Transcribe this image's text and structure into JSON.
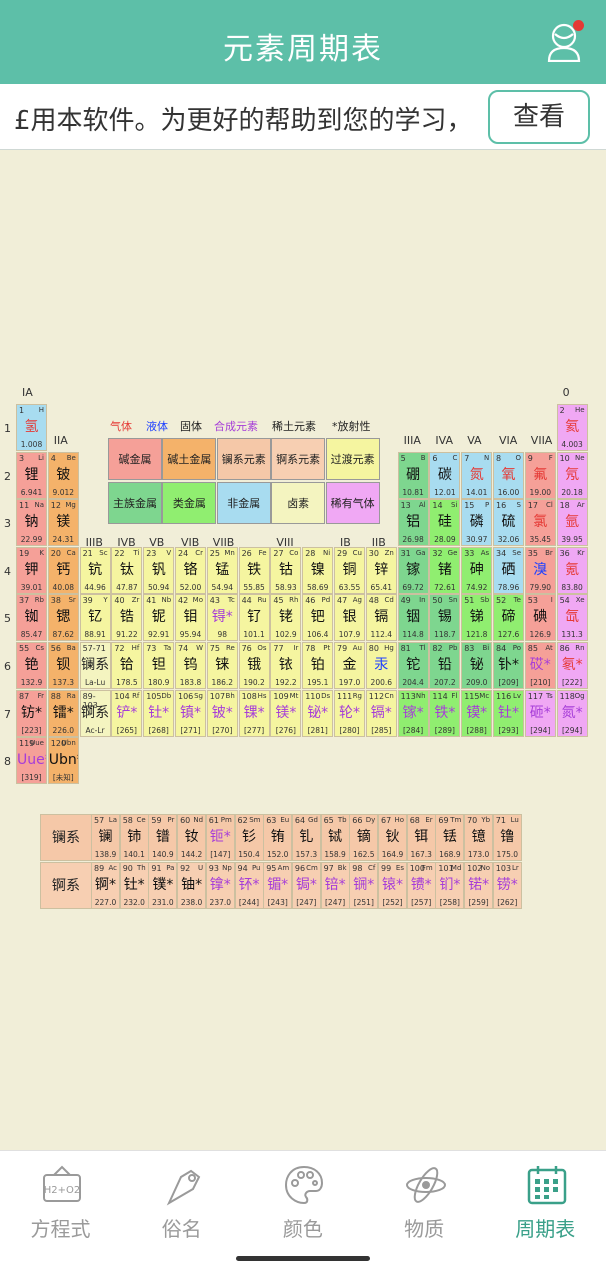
{
  "header": {
    "title": "元素周期表"
  },
  "banner": {
    "text": "£用本软件。为更好的帮助到您的学习，",
    "button": "查看"
  },
  "legend": {
    "gas": "气体",
    "liquid": "液体",
    "solid": "固体",
    "synthetic": "合成元素",
    "rare_earth": "稀土元素",
    "radioactive": "*放射性",
    "boxes": [
      "碱金属",
      "碱土金属",
      "镧系元素",
      "锕系元素",
      "过渡元素",
      "主族金属",
      "类金属",
      "非金属",
      "卤素",
      "稀有气体"
    ]
  },
  "groups": [
    "IA",
    "IIA",
    "IIIB",
    "IVB",
    "VB",
    "VIB",
    "VIIB",
    "VIII",
    "IB",
    "IIB",
    "IIIA",
    "IVA",
    "VA",
    "VIA",
    "VIIA",
    "0"
  ],
  "periods": [
    "1",
    "2",
    "3",
    "4",
    "5",
    "6",
    "7",
    "8"
  ],
  "placeholders": {
    "la": {
      "z": "57-71",
      "n": "镧系",
      "m": "La-Lu"
    },
    "ac": {
      "z": "89-103",
      "n": "锕系",
      "m": "Ac-Lr"
    }
  },
  "series_labels": {
    "lanthanides": "镧系",
    "actinides": "锕系"
  },
  "elements": [
    [
      "1",
      "H",
      "氢",
      "1.008",
      "hyd",
      "ng",
      0,
      0
    ],
    [
      "2",
      "He",
      "氦",
      "4.003",
      "nob",
      "ng",
      17,
      0
    ],
    [
      "3",
      "Li",
      "锂",
      "6.941",
      "alk",
      "",
      0,
      1
    ],
    [
      "4",
      "Be",
      "铍",
      "9.012",
      "ae",
      "",
      1,
      1
    ],
    [
      "5",
      "B",
      "硼",
      "10.81",
      "pm",
      "",
      12,
      1
    ],
    [
      "6",
      "C",
      "碳",
      "12.01",
      "hal",
      "",
      13,
      1
    ],
    [
      "7",
      "N",
      "氮",
      "14.01",
      "hal",
      "ng",
      14,
      1
    ],
    [
      "8",
      "O",
      "氧",
      "16.00",
      "hal",
      "ng",
      15,
      1
    ],
    [
      "9",
      "F",
      "氟",
      "19.00",
      "alk",
      "ng",
      16,
      1
    ],
    [
      "10",
      "Ne",
      "氖",
      "20.18",
      "nob",
      "ng",
      17,
      1
    ],
    [
      "11",
      "Na",
      "钠",
      "22.99",
      "alk",
      "",
      0,
      2
    ],
    [
      "12",
      "Mg",
      "镁",
      "24.31",
      "ae",
      "",
      1,
      2
    ],
    [
      "13",
      "Al",
      "铝",
      "26.98",
      "pm",
      "",
      12,
      2
    ],
    [
      "14",
      "Si",
      "硅",
      "28.09",
      "met",
      "",
      13,
      2
    ],
    [
      "15",
      "P",
      "磷",
      "30.97",
      "hal",
      "",
      14,
      2
    ],
    [
      "16",
      "S",
      "硫",
      "32.06",
      "hal",
      "",
      15,
      2
    ],
    [
      "17",
      "Cl",
      "氯",
      "35.45",
      "alk",
      "ng",
      16,
      2
    ],
    [
      "18",
      "Ar",
      "氩",
      "39.95",
      "nob",
      "ng",
      17,
      2
    ],
    [
      "19",
      "K",
      "钾",
      "39.01",
      "alk",
      "",
      0,
      3
    ],
    [
      "20",
      "Ca",
      "钙",
      "40.08",
      "ae",
      "",
      1,
      3
    ],
    [
      "21",
      "Sc",
      "钪",
      "44.96",
      "tm",
      "",
      2,
      3
    ],
    [
      "22",
      "Ti",
      "钛",
      "47.87",
      "tm",
      "",
      3,
      3
    ],
    [
      "23",
      "V",
      "钒",
      "50.94",
      "tm",
      "",
      4,
      3
    ],
    [
      "24",
      "Cr",
      "铬",
      "52.00",
      "tm",
      "",
      5,
      3
    ],
    [
      "25",
      "Mn",
      "锰",
      "54.94",
      "tm",
      "",
      6,
      3
    ],
    [
      "26",
      "Fe",
      "铁",
      "55.85",
      "tm",
      "",
      7,
      3
    ],
    [
      "27",
      "Co",
      "钴",
      "58.93",
      "tm",
      "",
      8,
      3
    ],
    [
      "28",
      "Ni",
      "镍",
      "58.69",
      "tm",
      "",
      9,
      3
    ],
    [
      "29",
      "Cu",
      "铜",
      "63.55",
      "tm",
      "",
      10,
      3
    ],
    [
      "30",
      "Zn",
      "锌",
      "65.41",
      "tm",
      "",
      11,
      3
    ],
    [
      "31",
      "Ga",
      "镓",
      "69.72",
      "pm",
      "",
      12,
      3
    ],
    [
      "32",
      "Ge",
      "锗",
      "72.61",
      "met",
      "",
      13,
      3
    ],
    [
      "33",
      "As",
      "砷",
      "74.92",
      "met",
      "",
      14,
      3
    ],
    [
      "34",
      "Se",
      "硒",
      "78.96",
      "hal",
      "",
      15,
      3
    ],
    [
      "35",
      "Br",
      "溴",
      "79.90",
      "alk",
      "lq",
      16,
      3
    ],
    [
      "36",
      "Kr",
      "氪",
      "83.80",
      "nob",
      "ng",
      17,
      3
    ],
    [
      "37",
      "Rb",
      "铷",
      "85.47",
      "alk",
      "",
      0,
      4
    ],
    [
      "38",
      "Sr",
      "锶",
      "87.62",
      "ae",
      "",
      1,
      4
    ],
    [
      "39",
      "Y",
      "钇",
      "88.91",
      "tm",
      "",
      2,
      4
    ],
    [
      "40",
      "Zr",
      "锆",
      "91.22",
      "tm",
      "",
      3,
      4
    ],
    [
      "41",
      "Nb",
      "铌",
      "92.91",
      "tm",
      "",
      4,
      4
    ],
    [
      "42",
      "Mo",
      "钼",
      "95.94",
      "tm",
      "",
      5,
      4
    ],
    [
      "43",
      "Tc",
      "锝*",
      "98",
      "tm",
      "sy",
      6,
      4
    ],
    [
      "44",
      "Ru",
      "钌",
      "101.1",
      "tm",
      "",
      7,
      4
    ],
    [
      "45",
      "Rh",
      "铑",
      "102.9",
      "tm",
      "",
      8,
      4
    ],
    [
      "46",
      "Pd",
      "钯",
      "106.4",
      "tm",
      "",
      9,
      4
    ],
    [
      "47",
      "Ag",
      "银",
      "107.9",
      "tm",
      "",
      10,
      4
    ],
    [
      "48",
      "Cd",
      "镉",
      "112.4",
      "tm",
      "",
      11,
      4
    ],
    [
      "49",
      "In",
      "铟",
      "114.8",
      "pm",
      "",
      12,
      4
    ],
    [
      "50",
      "Sn",
      "锡",
      "118.7",
      "pm",
      "",
      13,
      4
    ],
    [
      "51",
      "Sb",
      "锑",
      "121.8",
      "met",
      "",
      14,
      4
    ],
    [
      "52",
      "Te",
      "碲",
      "127.6",
      "met",
      "",
      15,
      4
    ],
    [
      "53",
      "I",
      "碘",
      "126.9",
      "alk",
      "",
      16,
      4
    ],
    [
      "54",
      "Xe",
      "氙",
      "131.3",
      "nob",
      "ng",
      17,
      4
    ],
    [
      "55",
      "Cs",
      "铯",
      "132.9",
      "alk",
      "",
      0,
      5
    ],
    [
      "56",
      "Ba",
      "钡",
      "137.3",
      "ae",
      "",
      1,
      5
    ],
    [
      "72",
      "Hf",
      "铪",
      "178.5",
      "tm",
      "",
      3,
      5
    ],
    [
      "73",
      "Ta",
      "钽",
      "180.9",
      "tm",
      "",
      4,
      5
    ],
    [
      "74",
      "W",
      "钨",
      "183.8",
      "tm",
      "",
      5,
      5
    ],
    [
      "75",
      "Re",
      "铼",
      "186.2",
      "tm",
      "",
      6,
      5
    ],
    [
      "76",
      "Os",
      "锇",
      "190.2",
      "tm",
      "",
      7,
      5
    ],
    [
      "77",
      "Ir",
      "铱",
      "192.2",
      "tm",
      "",
      8,
      5
    ],
    [
      "78",
      "Pt",
      "铂",
      "195.1",
      "tm",
      "",
      9,
      5
    ],
    [
      "79",
      "Au",
      "金",
      "197.0",
      "tm",
      "",
      10,
      5
    ],
    [
      "80",
      "Hg",
      "汞",
      "200.6",
      "tm",
      "lq",
      11,
      5
    ],
    [
      "81",
      "Tl",
      "铊",
      "204.4",
      "pm",
      "",
      12,
      5
    ],
    [
      "82",
      "Pb",
      "铅",
      "207.2",
      "pm",
      "",
      13,
      5
    ],
    [
      "83",
      "Bi",
      "铋",
      "209.0",
      "pm",
      "",
      14,
      5
    ],
    [
      "84",
      "Po",
      "钋*",
      "[209]",
      "pm",
      "",
      15,
      5
    ],
    [
      "85",
      "At",
      "砹*",
      "[210]",
      "alk",
      "sy",
      16,
      5
    ],
    [
      "86",
      "Rn",
      "氡*",
      "[222]",
      "nob",
      "ng",
      17,
      5
    ],
    [
      "87",
      "Fr",
      "钫*",
      "[223]",
      "alk",
      "",
      0,
      6
    ],
    [
      "88",
      "Ra",
      "镭*",
      "226.0",
      "ae",
      "",
      1,
      6
    ],
    [
      "104",
      "Rf",
      "铲*",
      "[265]",
      "tm",
      "sy",
      3,
      6
    ],
    [
      "105",
      "Db",
      "钍*",
      "[268]",
      "tm",
      "sy",
      4,
      6
    ],
    [
      "106",
      "Sg",
      "镇*",
      "[271]",
      "tm",
      "sy",
      5,
      6
    ],
    [
      "107",
      "Bh",
      "铍*",
      "[270]",
      "tm",
      "sy",
      6,
      6
    ],
    [
      "108",
      "Hs",
      "锞*",
      "[277]",
      "tm",
      "sy",
      7,
      6
    ],
    [
      "109",
      "Mt",
      "镁*",
      "[276]",
      "tm",
      "sy",
      8,
      6
    ],
    [
      "110",
      "Ds",
      "铋*",
      "[281]",
      "tm",
      "sy",
      9,
      6
    ],
    [
      "111",
      "Rg",
      "轮*",
      "[280]",
      "tm",
      "sy",
      10,
      6
    ],
    [
      "112",
      "Cn",
      "镉*",
      "[285]",
      "tm",
      "sy",
      11,
      6
    ],
    [
      "113",
      "Nh",
      "镓*",
      "[284]",
      "met",
      "sy",
      12,
      6
    ],
    [
      "114",
      "Fl",
      "铁*",
      "[289]",
      "met",
      "sy",
      13,
      6
    ],
    [
      "115",
      "Mc",
      "镆*",
      "[288]",
      "met",
      "sy",
      14,
      6
    ],
    [
      "116",
      "Lv",
      "钍*",
      "[293]",
      "met",
      "sy",
      15,
      6
    ],
    [
      "117",
      "Ts",
      "砸*",
      "[294]",
      "nob",
      "sy",
      16,
      6
    ],
    [
      "118",
      "Og",
      "氮*",
      "[294]",
      "nob",
      "sy",
      17,
      6
    ],
    [
      "119",
      "Uue",
      "Uue*",
      "[319]",
      "alk",
      "sy",
      0,
      7
    ],
    [
      "120",
      "Ubn",
      "Ubn*",
      "[未知]",
      "ae",
      "",
      1,
      7
    ]
  ],
  "lanthanides": [
    [
      "57",
      "La",
      "镧",
      "138.9",
      ""
    ],
    [
      "58",
      "Ce",
      "铈",
      "140.1",
      ""
    ],
    [
      "59",
      "Pr",
      "镨",
      "140.9",
      ""
    ],
    [
      "60",
      "Nd",
      "钕",
      "144.2",
      ""
    ],
    [
      "61",
      "Pm",
      "钷*",
      "[147]",
      "sy"
    ],
    [
      "62",
      "Sm",
      "钐",
      "150.4",
      ""
    ],
    [
      "63",
      "Eu",
      "铕",
      "152.0",
      ""
    ],
    [
      "64",
      "Gd",
      "钆",
      "157.3",
      ""
    ],
    [
      "65",
      "Tb",
      "铽",
      "158.9",
      ""
    ],
    [
      "66",
      "Dy",
      "镝",
      "162.5",
      ""
    ],
    [
      "67",
      "Ho",
      "钬",
      "164.9",
      ""
    ],
    [
      "68",
      "Er",
      "铒",
      "167.3",
      ""
    ],
    [
      "69",
      "Tm",
      "铥",
      "168.9",
      ""
    ],
    [
      "70",
      "Yb",
      "镱",
      "173.0",
      ""
    ],
    [
      "71",
      "Lu",
      "镥",
      "175.0",
      ""
    ]
  ],
  "actinides": [
    [
      "89",
      "Ac",
      "锕*",
      "227.0",
      ""
    ],
    [
      "90",
      "Th",
      "钍*",
      "232.0",
      ""
    ],
    [
      "91",
      "Pa",
      "镤*",
      "231.0",
      ""
    ],
    [
      "92",
      "U",
      "铀*",
      "238.0",
      ""
    ],
    [
      "93",
      "Np",
      "镎*",
      "237.0",
      "sy"
    ],
    [
      "94",
      "Pu",
      "钚*",
      "[244]",
      "sy"
    ],
    [
      "95",
      "Am",
      "镅*",
      "[243]",
      "sy"
    ],
    [
      "96",
      "Cm",
      "锔*",
      "[247]",
      "sy"
    ],
    [
      "97",
      "Bk",
      "锫*",
      "[247]",
      "sy"
    ],
    [
      "98",
      "Cf",
      "锎*",
      "[251]",
      "sy"
    ],
    [
      "99",
      "Es",
      "锿*",
      "[252]",
      "sy"
    ],
    [
      "100",
      "Fm",
      "镄*",
      "[257]",
      "sy"
    ],
    [
      "101",
      "Md",
      "钔*",
      "[258]",
      "sy"
    ],
    [
      "102",
      "No",
      "锘*",
      "[259]",
      "sy"
    ],
    [
      "103",
      "Lr",
      "铹*",
      "[262]",
      "sy"
    ]
  ],
  "tabs": [
    {
      "label": "方程式",
      "icon": "equation-icon"
    },
    {
      "label": "俗名",
      "icon": "tag-icon"
    },
    {
      "label": "颜色",
      "icon": "palette-icon"
    },
    {
      "label": "物质",
      "icon": "atom-icon"
    },
    {
      "label": "周期表",
      "icon": "calendar-grid-icon"
    }
  ],
  "colors": {
    "accent": "#5dbfa8",
    "active_tab": "#3aa089"
  }
}
